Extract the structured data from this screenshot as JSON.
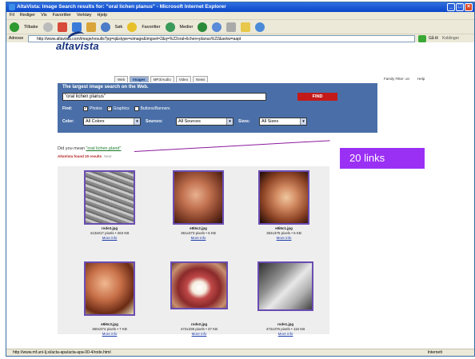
{
  "window": {
    "title": "AltaVista: Image Search results for: \"oral lichen planus\" - Microsoft Internet Explorer"
  },
  "menu": [
    "Fil",
    "Rediger",
    "Vis",
    "Favoritter",
    "Verktøy",
    "Hjelp"
  ],
  "toolbar": {
    "back": "Tilbake",
    "search": "Søk",
    "favorites": "Favoritter",
    "media": "Medier"
  },
  "address": {
    "label": "Adresse",
    "url": "http://www.altavista.com/image/results?pg=q&stype=simage&imgset=2&q=%22oral+lichen+planus%22&avkw=aapt",
    "go": "Gå til",
    "links": "Koblinger"
  },
  "site": {
    "logo": "altavista",
    "tabs": [
      "Web",
      "Images",
      "MP3/Audio",
      "Video",
      "News"
    ],
    "active_tab_index": 1,
    "toplinks": [
      "Family Filter: on",
      "Help"
    ]
  },
  "search": {
    "heading": "The largest image search on the Web.",
    "query": "\"oral lichen planus\"",
    "find_button": "FIND",
    "find_label": "Find:",
    "checkboxes": [
      {
        "label": "Photos",
        "checked": true
      },
      {
        "label": "Graphics",
        "checked": true
      },
      {
        "label": "Buttons/Banners",
        "checked": false
      }
    ],
    "color_label": "Color:",
    "color_value": "All Colors",
    "sources_label": "Sources:",
    "sources_value": "All Sources",
    "sizes_label": "Sizes:",
    "sizes_value": "All Sizes"
  },
  "results_header": {
    "did_you_mean": "Did you mean",
    "suggestion": "\"oral lichen pland\"",
    "found": "AltaVista found 20 results",
    "next": "Next"
  },
  "callout": {
    "text": "20 links",
    "color": "#9b30f5"
  },
  "results": [
    {
      "name": "rode3.jpg",
      "info": "413x817 pixels • 263 KB",
      "more": "More info",
      "tone": "gray"
    },
    {
      "name": "e8i6c2.jpg",
      "info": "361x373 pixels • 6 KB",
      "more": "More info",
      "tone": "pink"
    },
    {
      "name": "e8i6c1.jpg",
      "info": "364x375 pixels • 6 KB",
      "more": "More info",
      "tone": "pink"
    },
    {
      "name": "e8i6c3.jpg",
      "info": "360x374 pixels • 7 KB",
      "more": "More info",
      "tone": "pink"
    },
    {
      "name": "rode2.jpg",
      "info": "472x336 pixels • 37 KB",
      "more": "More info",
      "tone": "mouth"
    },
    {
      "name": "rode1.jpg",
      "info": "472x376 pixels • 116 KB",
      "more": "More info",
      "tone": "gray2"
    }
  ],
  "status": {
    "url": "http://www.mf.uni-lj.si/acta-apa/acta-apa-00-4/rode.html",
    "zone": "Internett"
  }
}
